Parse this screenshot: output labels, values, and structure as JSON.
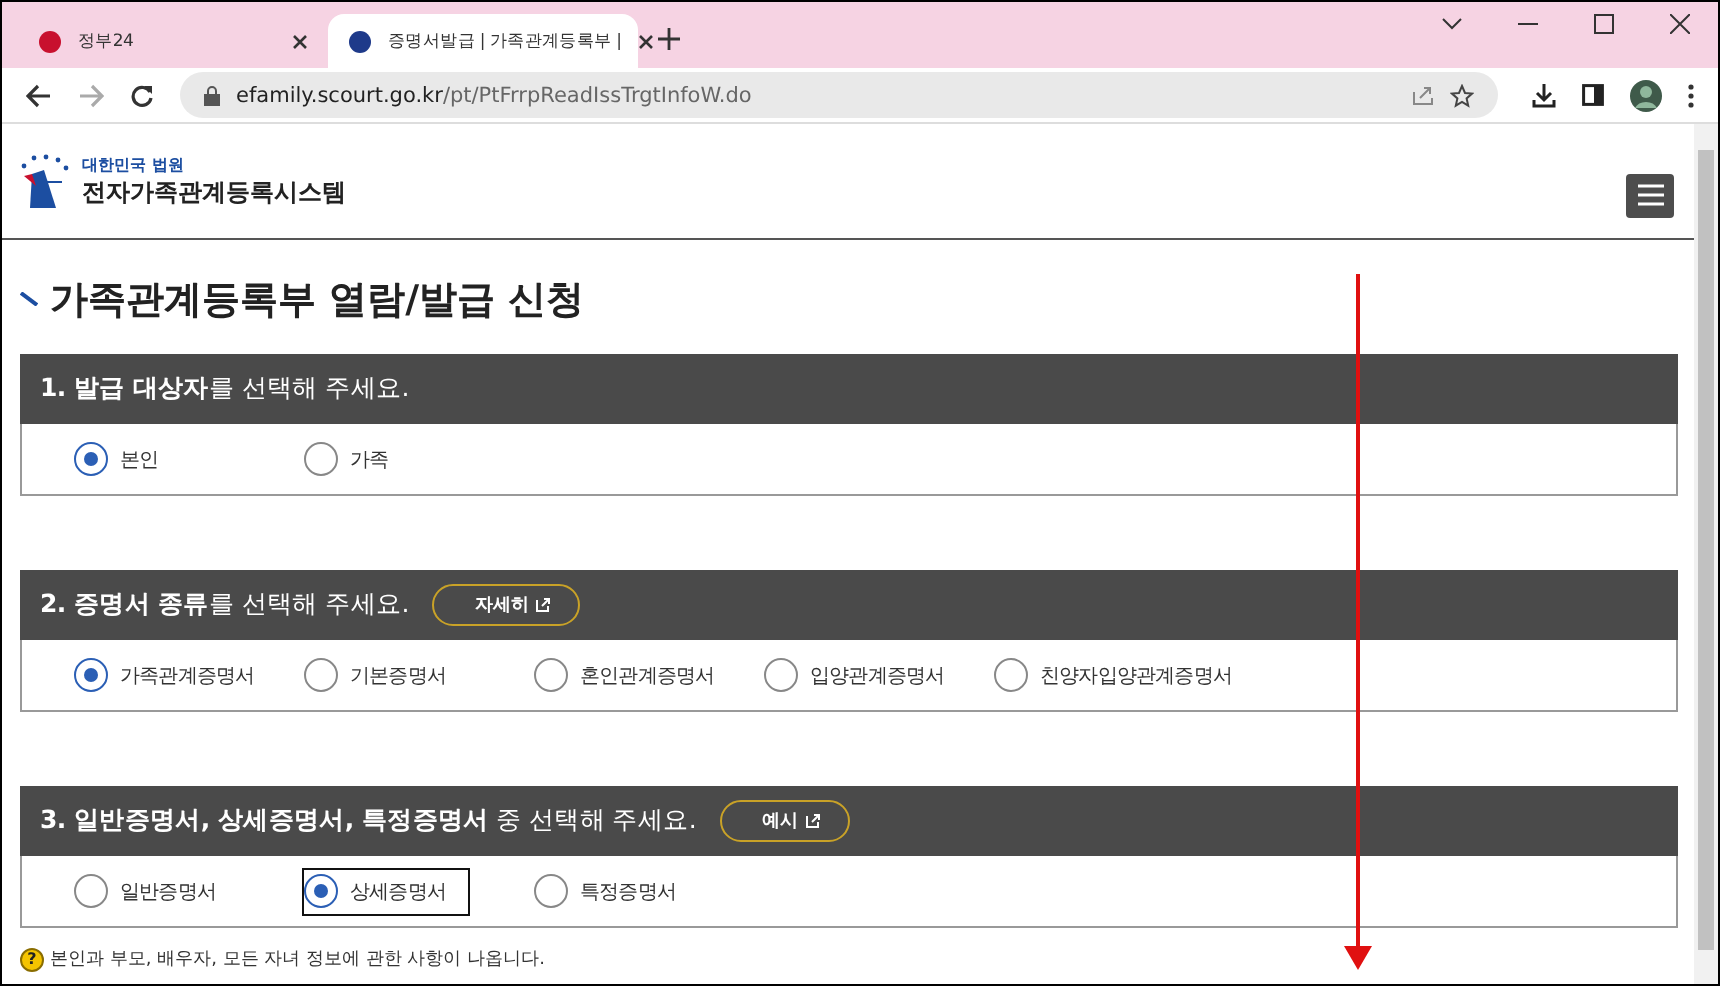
{
  "browser": {
    "tabs": [
      {
        "title": "정부24",
        "selected": false
      },
      {
        "title": "증명서발급 | 가족관계등록부 |",
        "selected": true
      }
    ],
    "url_host": "efamily.scourt.go.kr",
    "url_path": "/pt/PtFrrpReadIssTrgtInfoW.do"
  },
  "site": {
    "org": "대한민국 법원",
    "name": "전자가족관계등록시스템"
  },
  "page_title": "가족관계등록부 열람/발급 신청",
  "sections": [
    {
      "title": "**1. 발급 대상자**를 선택해 주세요.",
      "options": [
        {
          "label": "본인",
          "selected": true,
          "focused": false
        },
        {
          "label": "가족",
          "selected": false,
          "focused": false
        }
      ]
    },
    {
      "title": "**2. 증명서 종류**를 선택해 주세요.",
      "button": "자세히",
      "options": [
        {
          "label": "가족관계증명서",
          "selected": true,
          "focused": false
        },
        {
          "label": "기본증명서",
          "selected": false,
          "focused": false
        },
        {
          "label": "혼인관계증명서",
          "selected": false,
          "focused": false
        },
        {
          "label": "입양관계증명서",
          "selected": false,
          "focused": false
        },
        {
          "label": "친양자입양관계증명서",
          "selected": false,
          "focused": false
        }
      ]
    },
    {
      "title": "**3. 일반증명서, 상세증명서, 특정증명서** 중 선택해 주세요.",
      "button": "예시",
      "options": [
        {
          "label": "일반증명서",
          "selected": false,
          "focused": false
        },
        {
          "label": "상세증명서",
          "selected": true,
          "focused": true
        },
        {
          "label": "특정증명서",
          "selected": false,
          "focused": false
        }
      ]
    }
  ],
  "note": {
    "icon": "?",
    "text": "본인과 부모, 배우자, 모든 자녀 정보에 관한 사항이 나옵니다."
  }
}
